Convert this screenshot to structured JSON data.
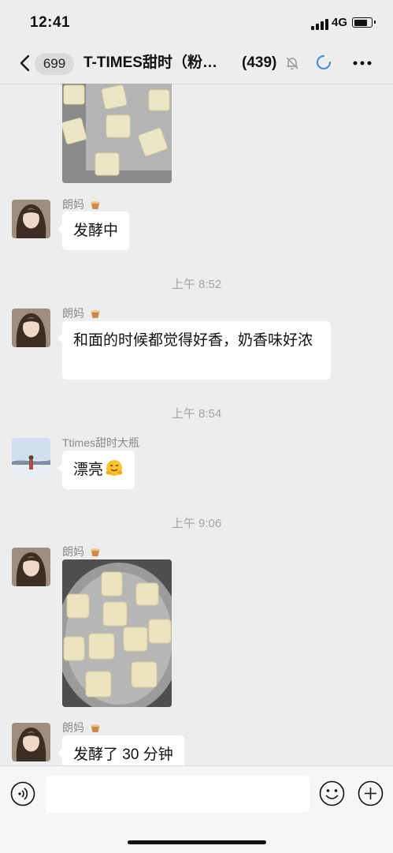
{
  "status_bar": {
    "time": "12:41",
    "network": "4G"
  },
  "nav": {
    "unread_count": "699",
    "title": "T-TIMES甜时（粉…",
    "member_count": "(439)"
  },
  "messages": [
    {
      "type": "image",
      "sender": "",
      "content": ""
    },
    {
      "type": "text",
      "sender": "朗妈",
      "content": "发酵中"
    },
    {
      "type": "timestamp",
      "content": "上午 8:52"
    },
    {
      "type": "text",
      "sender": "朗妈",
      "content": "和面的时候都觉得好香，奶香味好浓"
    },
    {
      "type": "timestamp",
      "content": "上午 8:54"
    },
    {
      "type": "text",
      "sender": "Ttimes甜时大瓶",
      "content": "漂亮"
    },
    {
      "type": "timestamp",
      "content": "上午 9:06"
    },
    {
      "type": "image",
      "sender": "朗妈",
      "content": ""
    },
    {
      "type": "text",
      "sender": "朗妈",
      "content": "发酵了 30 分钟"
    }
  ],
  "icons": {
    "back": "chevron-left-icon",
    "mute": "bell-off-icon",
    "loading": "loading-spinner-icon",
    "more": "more-icon",
    "voice": "voice-icon",
    "emoji": "emoji-icon",
    "add": "plus-icon",
    "sender_badge": "cupcake-icon",
    "reaction": "hugging-face-emoji"
  },
  "colors": {
    "background": "#ededed",
    "bubble": "#ffffff",
    "timestamp": "#a3a3a3",
    "sender_name": "#8a8a8a",
    "spinner": "#4a90d9"
  }
}
